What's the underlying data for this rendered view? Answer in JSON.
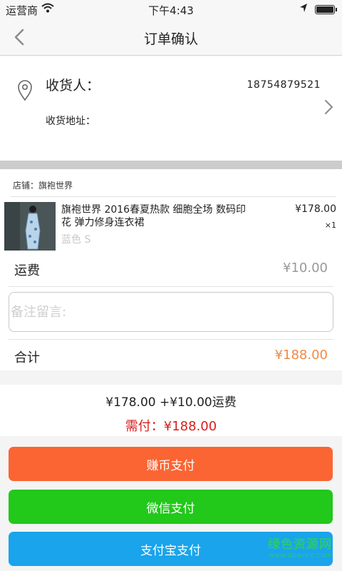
{
  "status_bar": {
    "carrier": "运营商",
    "time": "下午4:43",
    "location_icon": "location-arrow-icon",
    "wifi_icon": "wifi-icon",
    "battery_icon": "battery-icon"
  },
  "nav": {
    "title": "订单确认",
    "back_icon": "chevron-left-icon"
  },
  "address": {
    "receiver_label": "收货人：",
    "phone": "18754879521",
    "address_label": "收货地址：",
    "pin_icon": "location-pin-icon",
    "chevron_icon": "chevron-right-icon"
  },
  "order": {
    "shop_label": "店铺：旗袍世界",
    "product": {
      "name": "旗袍世界 2016春夏热款 细胞全场 数码印花 弹力修身连衣裙",
      "variant": "蓝色 S",
      "price": "¥178.00",
      "quantity": "×1"
    },
    "shipping_label": "运费",
    "shipping_value": "¥10.00",
    "remark_placeholder": "备注留言:",
    "total_label": "合计",
    "total_value": "¥188.00"
  },
  "summary": {
    "breakdown": "¥178.00 +¥10.00运费",
    "due": "需付：¥188.00"
  },
  "payment_buttons": [
    {
      "label": "赚币支付",
      "color": "#fa6533"
    },
    {
      "label": "微信支付",
      "color": "#22c81a"
    },
    {
      "label": "支付宝支付",
      "color": "#19a4ec"
    }
  ],
  "watermark": {
    "main": "绿色资源网",
    "sub": "www.downcc.com"
  },
  "colors": {
    "accent_total": "#ee8a47",
    "due": "#d91e1e",
    "separator": "#cccccc"
  }
}
